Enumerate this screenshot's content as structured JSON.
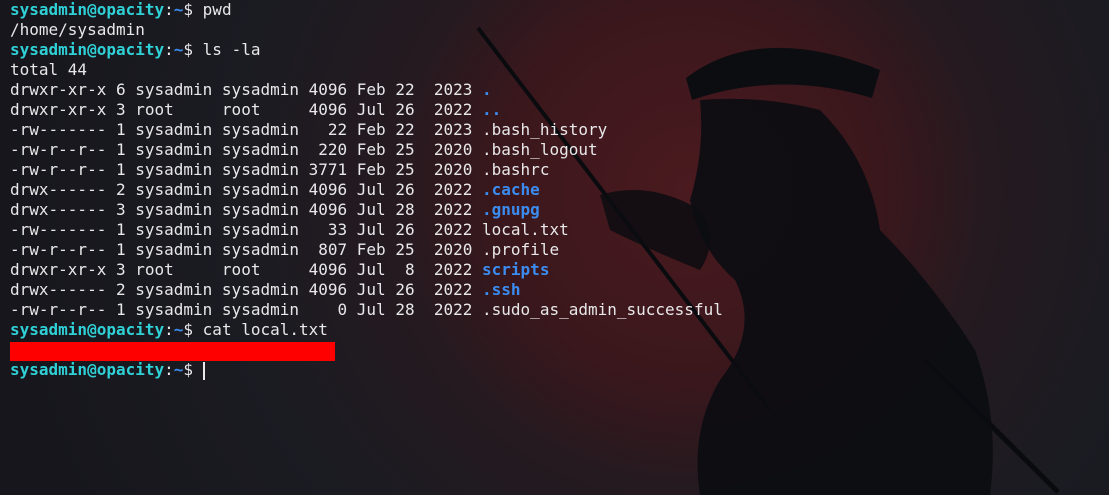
{
  "terminal": {
    "prompt": {
      "user": "sysadmin@opacity",
      "sep": ":",
      "path": "~",
      "symbol": "$ "
    },
    "commands": [
      "pwd",
      "ls -la",
      "cat local.txt"
    ],
    "pwd_output": "/home/sysadmin",
    "total": "total 44",
    "listing": [
      {
        "meta": "drwxr-xr-x 6 sysadmin sysadmin 4096 Feb 22  2023 ",
        "name": ".",
        "is_dir": true
      },
      {
        "meta": "drwxr-xr-x 3 root     root     4096 Jul 26  2022 ",
        "name": "..",
        "is_dir": true
      },
      {
        "meta": "-rw------- 1 sysadmin sysadmin   22 Feb 22  2023 ",
        "name": ".bash_history",
        "is_dir": false
      },
      {
        "meta": "-rw-r--r-- 1 sysadmin sysadmin  220 Feb 25  2020 ",
        "name": ".bash_logout",
        "is_dir": false
      },
      {
        "meta": "-rw-r--r-- 1 sysadmin sysadmin 3771 Feb 25  2020 ",
        "name": ".bashrc",
        "is_dir": false
      },
      {
        "meta": "drwx------ 2 sysadmin sysadmin 4096 Jul 26  2022 ",
        "name": ".cache",
        "is_dir": true
      },
      {
        "meta": "drwx------ 3 sysadmin sysadmin 4096 Jul 28  2022 ",
        "name": ".gnupg",
        "is_dir": true
      },
      {
        "meta": "-rw------- 1 sysadmin sysadmin   33 Jul 26  2022 ",
        "name": "local.txt",
        "is_dir": false
      },
      {
        "meta": "-rw-r--r-- 1 sysadmin sysadmin  807 Feb 25  2020 ",
        "name": ".profile",
        "is_dir": false
      },
      {
        "meta": "drwxr-xr-x 3 root     root     4096 Jul  8  2022 ",
        "name": "scripts",
        "is_dir": true
      },
      {
        "meta": "drwx------ 2 sysadmin sysadmin 4096 Jul 26  2022 ",
        "name": ".ssh",
        "is_dir": true
      },
      {
        "meta": "-rw-r--r-- 1 sysadmin sysadmin    0 Jul 28  2022 ",
        "name": ".sudo_as_admin_successful",
        "is_dir": false
      }
    ]
  },
  "colors": {
    "prompt_user": "#2fd0d6",
    "prompt_path": "#3b8cf0",
    "directory": "#3b8cf0",
    "text": "#e8e8ea",
    "redaction": "#ff0000"
  }
}
